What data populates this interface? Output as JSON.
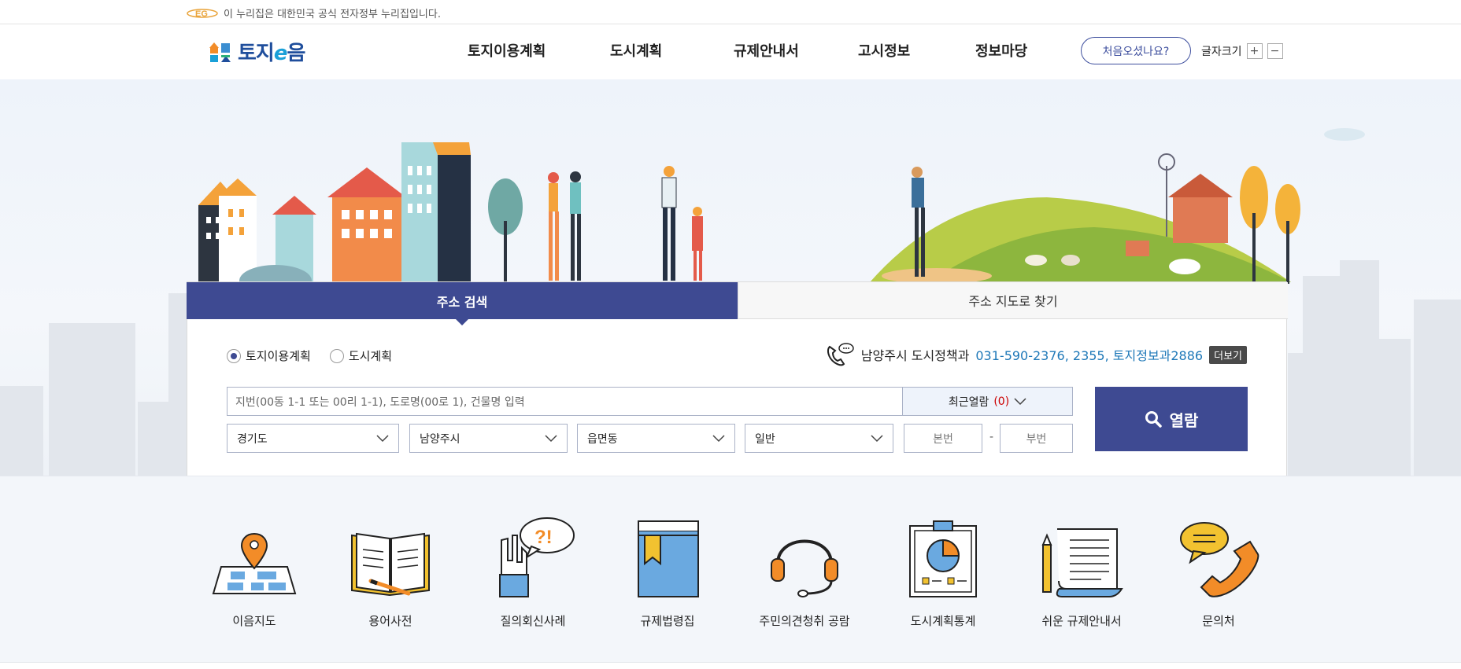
{
  "gov_banner": {
    "text": "이 누리집은 대한민국 공식 전자정부 누리집입니다."
  },
  "header": {
    "logo": "토지e음",
    "nav": [
      "토지이용계획",
      "도시계획",
      "규제안내서",
      "고시정보",
      "정보마당"
    ],
    "first_visit": "처음오셨나요?",
    "font_size_label": "글자크기",
    "font_plus": "+",
    "font_minus": "−"
  },
  "search": {
    "tabs": [
      "주소 검색",
      "주소 지도로 찾기"
    ],
    "radio_options": [
      {
        "label": "토지이용계획",
        "checked": true
      },
      {
        "label": "도시계획",
        "checked": false
      }
    ],
    "contact_prefix": "남양주시 도시정책과",
    "contact_numbers": "031-590-2376, 2355, 토지정보과2886",
    "more": "더보기",
    "address_placeholder": "지번(00동 1-1 또는 00리 1-1), 도로명(00로 1), 건물명 입력",
    "recent_label": "최근열람",
    "recent_count": "(0)",
    "selects": [
      "경기도",
      "남양주시",
      "읍면동",
      "일반"
    ],
    "main_no_placeholder": "본번",
    "dash": "-",
    "sub_no_placeholder": "부번",
    "submit": "열람"
  },
  "quick_links": [
    {
      "label": "이음지도",
      "icon": "map-pin-icon"
    },
    {
      "label": "용어사전",
      "icon": "open-book-icon"
    },
    {
      "label": "질의회신사례",
      "icon": "question-hand-icon"
    },
    {
      "label": "규제법령집",
      "icon": "law-book-icon"
    },
    {
      "label": "주민의견청취 공람",
      "icon": "headset-icon"
    },
    {
      "label": "도시계획통계",
      "icon": "statistics-chart-icon"
    },
    {
      "label": "쉬운 규제안내서",
      "icon": "document-pencil-icon"
    },
    {
      "label": "문의처",
      "icon": "phone-chat-icon"
    }
  ],
  "colors": {
    "primary": "#3e4a92",
    "link_blue": "#1e78b8",
    "accent_orange": "#f4a23a"
  }
}
